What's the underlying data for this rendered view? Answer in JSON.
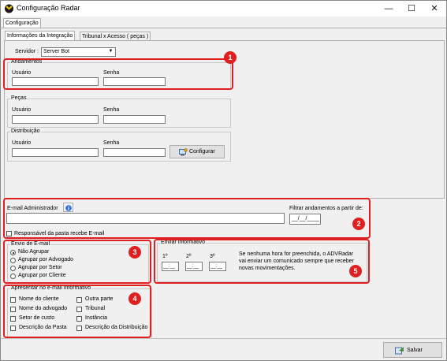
{
  "window": {
    "title": "Configuração Radar",
    "controls": {
      "minimize": "—",
      "maximize": "☐",
      "close": "✕"
    }
  },
  "top_tab": "Configuração",
  "tabs": [
    "Informações da Integração",
    "Tribunal x Acesso ( peças )"
  ],
  "server": {
    "label": "Servidor :",
    "value": "Server Bot"
  },
  "groups": {
    "andamentos": {
      "title": "Andamentos",
      "user_label": "Usuário",
      "pass_label": "Senha"
    },
    "pecas": {
      "title": "Peças",
      "user_label": "Usuário",
      "pass_label": "Senha"
    },
    "distribuicao": {
      "title": "Distribuição",
      "user_label": "Usuário",
      "pass_label": "Senha",
      "config_button": "Configurar"
    }
  },
  "email_admin": {
    "label": "E-mail Administrador",
    "info_icon": "info-icon"
  },
  "filter": {
    "label": "Filtrar andamentos a partir de:",
    "value": "__/__/____"
  },
  "responsible_check": "Responsável da pasta recebe E-mail",
  "envio": {
    "title": "Envio de E-mail",
    "options": [
      "Não Agrupar",
      "Agrupar por Advogado",
      "Agrupar por Setor",
      "Agrupar por Cliente"
    ],
    "selected": 0
  },
  "informativo": {
    "title": "Enviar informativo",
    "slots": [
      "1º",
      "2º",
      "3º"
    ],
    "time_placeholder": "__:__",
    "note": "Se nenhuma hora for preenchida, o ADVRadar vai enviar um comunicado sempre que receber novas movimentações."
  },
  "apresentar": {
    "title": "Apresentar no e-mail informativo",
    "left": [
      "Nome do cliente",
      "Nome do advogado",
      "Setor de custo",
      "Descrição da Pasta"
    ],
    "right": [
      "Outra parte",
      "Tribunal",
      "Instância",
      "Descrição da Distribuição"
    ]
  },
  "save_button": "Salvar",
  "badges": [
    "1",
    "2",
    "3",
    "4",
    "5"
  ],
  "accent": {
    "highlight": "#e02020",
    "window_bg": "#f0f0f0"
  }
}
